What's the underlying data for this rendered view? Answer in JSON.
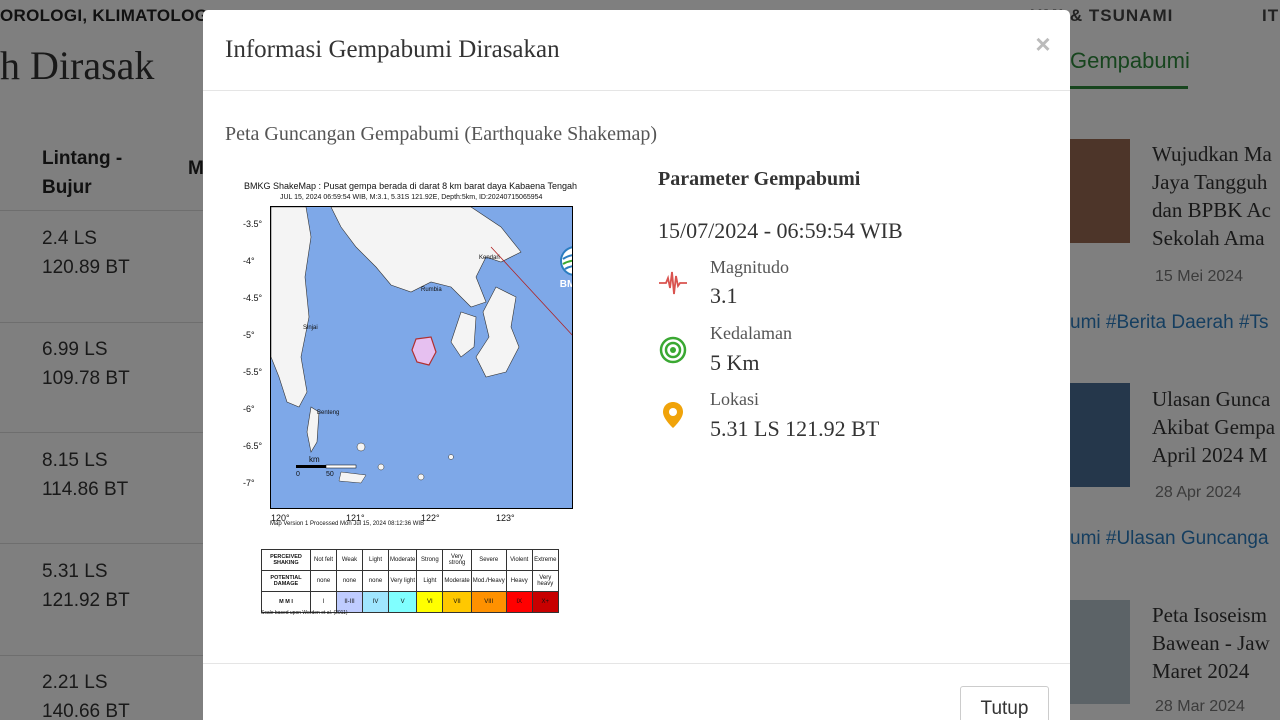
{
  "background": {
    "brand": "OROLOGI, KLIMATOLOG",
    "nav_item": "UMI & TSUNAMI",
    "nav_item_edge": "IT",
    "page_heading": "h Dirasak",
    "table": {
      "header_coord": "Lintang -\nBujur",
      "header_m": "M",
      "rows": [
        {
          "lat": "2.4 LS",
          "lon": "120.89 BT"
        },
        {
          "lat": "6.99 LS",
          "lon": "109.78 BT"
        },
        {
          "lat": "8.15 LS",
          "lon": "114.86 BT"
        },
        {
          "lat": "5.31 LS",
          "lon": "121.92 BT"
        },
        {
          "lat": "2.21 LS",
          "lon": "140.66 BT"
        }
      ]
    },
    "right_tab": "Gempabumi",
    "news": [
      {
        "title": "Wujudkan Ma\nJaya Tangguh\ndan BPBK Ac\nSekolah Ama",
        "date": "15 Mei 2024"
      },
      {
        "title": "Ulasan Gunca\nAkibat Gempa\nApril 2024 M",
        "date": "28 Apr 2024"
      },
      {
        "title": "Peta Isoseism\nBawean - Jaw\nMaret 2024",
        "date": "28 Mar 2024"
      }
    ],
    "tags": [
      "umi #Berita Daerah #Ts",
      "umi #Ulasan Guncanga"
    ]
  },
  "modal": {
    "title": "Informasi Gempabumi Dirasakan",
    "close_symbol": "×",
    "section_title": "Peta Guncangan Gempabumi (Earthquake Shakemap)",
    "map": {
      "caption": "BMKG ShakeMap : Pusat gempa berada di darat 8 km barat daya Kabaena Tengah",
      "subcaption": "JUL 15, 2024 06:59:54 WIB, M:3.1, 5.31S 121.92E, Depth:5km, ID:20240715065954",
      "version": "Map Version 1 Processed Mon Jul 15, 2024 08:12:36 WIB",
      "logo_text": "BMKG",
      "lat_ticks": [
        "-3.5°",
        "-4°",
        "-4.5°",
        "-5°",
        "-5.5°",
        "-6°",
        "-6.5°",
        "-7°"
      ],
      "lon_ticks": [
        "120°",
        "121°",
        "122°",
        "123°"
      ],
      "places": [
        "Kendari",
        "Rumbia",
        "Sinjai",
        "Benteng"
      ],
      "scale_label": "km",
      "scale_ticks": [
        "0",
        "50"
      ],
      "mmi": {
        "row_labels": [
          "PERCEIVED SHAKING",
          "POTENTIAL DAMAGE",
          "M M I"
        ],
        "shaking": [
          "Not felt",
          "Weak",
          "Light",
          "Moderate",
          "Strong",
          "Very strong",
          "Severe",
          "Violent",
          "Extreme"
        ],
        "damage": [
          "none",
          "none",
          "none",
          "Very light",
          "Light",
          "Moderate",
          "Mod./Heavy",
          "Heavy",
          "Very heavy"
        ],
        "levels": [
          "I",
          "II-III",
          "IV",
          "V",
          "VI",
          "VII",
          "VIII",
          "IX",
          "X+"
        ],
        "colors": [
          "#ffffff",
          "#bfccff",
          "#a0e6ff",
          "#80ffff",
          "#ffff00",
          "#ffc800",
          "#ff9100",
          "#ff0000",
          "#c80000"
        ],
        "note": "Scale based upon Worden et al. (2011)"
      }
    },
    "parameters": {
      "title": "Parameter Gempabumi",
      "datetime": "15/07/2024 - 06:59:54 WIB",
      "items": [
        {
          "label": "Magnitudo",
          "value": "3.1",
          "icon": "seismograph-icon",
          "color": "#d9534f"
        },
        {
          "label": "Kedalaman",
          "value": "5 Km",
          "icon": "depth-target-icon",
          "color": "#3aa832"
        },
        {
          "label": "Lokasi",
          "value": "5.31 LS 121.92 BT",
          "icon": "location-pin-icon",
          "color": "#f0a30a"
        }
      ]
    },
    "close_button": "Tutup"
  }
}
